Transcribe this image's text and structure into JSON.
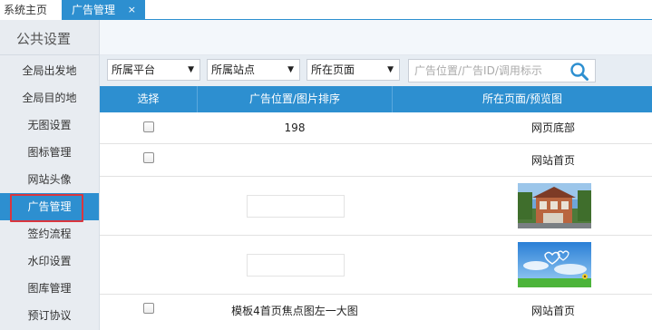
{
  "tabs": {
    "home": "系统主页",
    "active": "广告管理",
    "close": "×"
  },
  "sidebar": {
    "title": "公共设置",
    "items": [
      {
        "label": "全局出发地"
      },
      {
        "label": "全局目的地"
      },
      {
        "label": "无图设置"
      },
      {
        "label": "图标管理"
      },
      {
        "label": "网站头像"
      },
      {
        "label": "广告管理",
        "active": true
      },
      {
        "label": "签约流程"
      },
      {
        "label": "水印设置"
      },
      {
        "label": "图库管理"
      },
      {
        "label": "预订协议"
      }
    ]
  },
  "filters": {
    "platform": "所属平台",
    "site": "所属站点",
    "page": "所在页面",
    "search_placeholder": "广告位置/广告ID/调用标示"
  },
  "table": {
    "headers": {
      "select": "选择",
      "position": "广告位置/图片排序",
      "page_preview": "所在页面/预览图"
    },
    "rows": [
      {
        "position": "198",
        "page": "网页底部"
      },
      {
        "position": "",
        "page": "网站首页"
      },
      {
        "position": "",
        "page": "",
        "thumb": "house-photo"
      },
      {
        "position": "",
        "page": "",
        "thumb": "sky-hearts-photo"
      },
      {
        "position": "模板4首页焦点图左一大图",
        "page": "网站首页"
      }
    ]
  },
  "colors": {
    "accent": "#2d8fd0",
    "highlight_border": "#d9363e",
    "sidebar_bg": "#e8ecf1"
  },
  "icons": {
    "search": "search-icon",
    "caret": "caret-down-icon",
    "close": "close-icon"
  }
}
